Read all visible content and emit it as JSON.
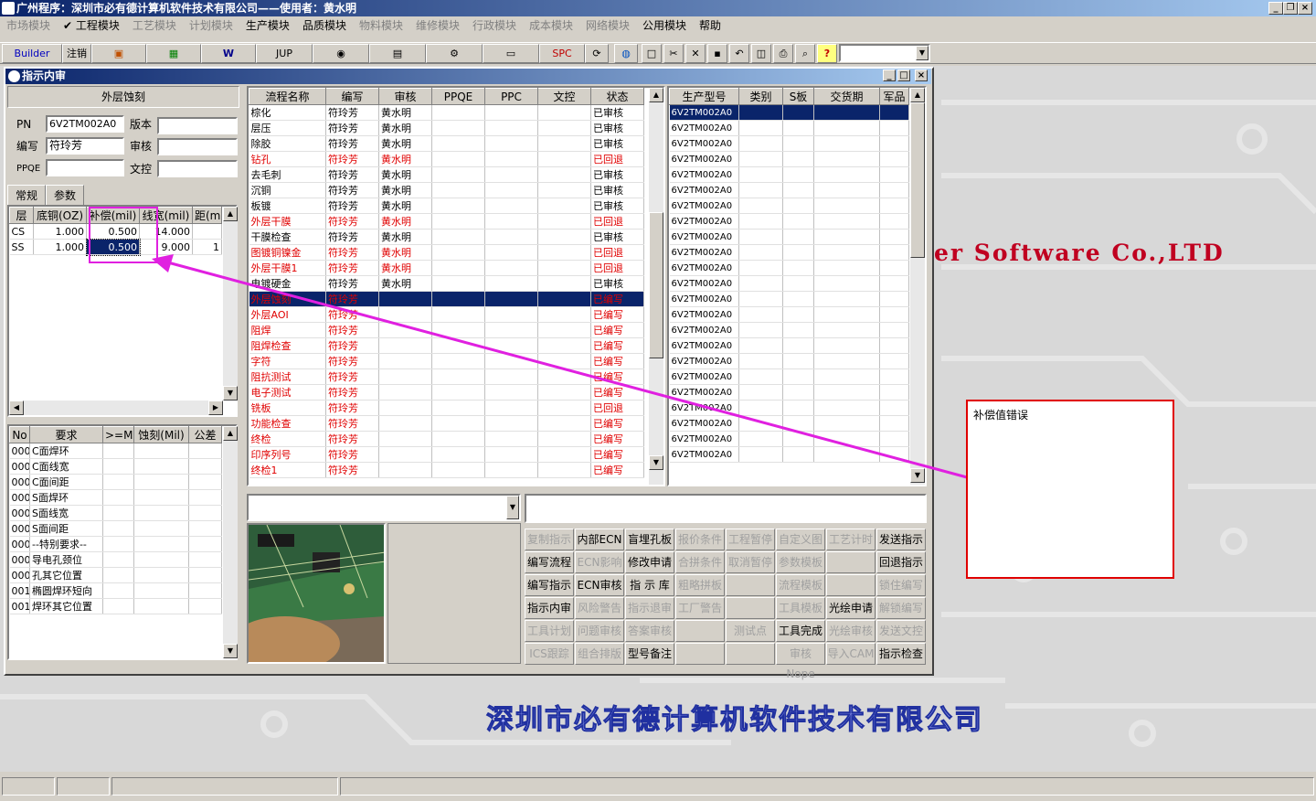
{
  "app": {
    "title": "广州程序：深圳市必有德计算机软件技术有限公司——使用者：黄水明"
  },
  "menu": [
    {
      "label": "市场模块",
      "enabled": false
    },
    {
      "label": "✔ 工程模块",
      "enabled": true
    },
    {
      "label": "工艺模块",
      "enabled": false
    },
    {
      "label": "计划模块",
      "enabled": false
    },
    {
      "label": "生产模块",
      "enabled": true
    },
    {
      "label": "品质模块",
      "enabled": true
    },
    {
      "label": "物料模块",
      "enabled": false
    },
    {
      "label": "维修模块",
      "enabled": false
    },
    {
      "label": "行政模块",
      "enabled": false
    },
    {
      "label": "成本模块",
      "enabled": false
    },
    {
      "label": "网络模块",
      "enabled": false
    },
    {
      "label": "公用模块",
      "enabled": true
    },
    {
      "label": "帮助",
      "enabled": true
    }
  ],
  "toolbar": {
    "builder": "Builder",
    "logout": "注销",
    "jup": "JUP",
    "spc": "SPC"
  },
  "desktop": {
    "company_en": "er Software Co.,LTD",
    "company_cn": "深圳市必有德计算机软件技术有限公司"
  },
  "window": {
    "title": "指示内审"
  },
  "left": {
    "process_title": "外层蚀刻",
    "pn_label": "PN",
    "pn": "6V2TM002A0",
    "version_label": "版本",
    "writer_label": "编写",
    "writer": "符玲芳",
    "review_label": "审核",
    "ppqe_label": "PPQE",
    "doc_label": "文控",
    "tabs": [
      "常规",
      "参数"
    ],
    "param_headers": [
      "层",
      "底铜(OZ)",
      "补偿(mil)",
      "线宽(mil)",
      "距(mi"
    ],
    "params": [
      [
        "CS",
        "1.000",
        "0.500",
        "14.000",
        ""
      ],
      [
        "SS",
        "1.000",
        "0.500",
        "9.000",
        "1"
      ]
    ],
    "req_headers": [
      "No",
      "要求",
      ">=Mil",
      "蚀刻(Mil)",
      "公差"
    ],
    "reqs": [
      [
        "000",
        "C面焊环"
      ],
      [
        "000",
        "C面线宽"
      ],
      [
        "000",
        "C面间距"
      ],
      [
        "000",
        "S面焊环"
      ],
      [
        "000",
        "S面线宽"
      ],
      [
        "000",
        "S面间距"
      ],
      [
        "000",
        "--特别要求--"
      ],
      [
        "000",
        "导电孔颈位"
      ],
      [
        "000",
        "孔其它位置"
      ],
      [
        "001",
        "椭圆焊环短向"
      ],
      [
        "001",
        "焊环其它位置"
      ]
    ]
  },
  "flow": {
    "headers": [
      "流程名称",
      "编写",
      "审核",
      "PPQE",
      "PPC",
      "文控",
      "状态"
    ],
    "rows": [
      [
        "棕化",
        "符玲芳",
        "黄水明",
        "已审核",
        "n"
      ],
      [
        "层压",
        "符玲芳",
        "黄水明",
        "已审核",
        "n"
      ],
      [
        "除胶",
        "符玲芳",
        "黄水明",
        "已审核",
        "n"
      ],
      [
        "钻孔",
        "符玲芳",
        "黄水明",
        "已回退",
        "r"
      ],
      [
        "去毛刺",
        "符玲芳",
        "黄水明",
        "已审核",
        "n"
      ],
      [
        "沉铜",
        "符玲芳",
        "黄水明",
        "已审核",
        "n"
      ],
      [
        "板镀",
        "符玲芳",
        "黄水明",
        "已审核",
        "n"
      ],
      [
        "外层干膜",
        "符玲芳",
        "黄水明",
        "已回退",
        "r"
      ],
      [
        "干膜检查",
        "符玲芳",
        "黄水明",
        "已审核",
        "n"
      ],
      [
        "图镀铜镍金",
        "符玲芳",
        "黄水明",
        "已回退",
        "r"
      ],
      [
        "外层干膜1",
        "符玲芳",
        "黄水明",
        "已回退",
        "r"
      ],
      [
        "电镀硬金",
        "符玲芳",
        "黄水明",
        "已审核",
        "n"
      ],
      [
        "外层蚀刻",
        "符玲芳",
        "",
        "已编写",
        "s"
      ],
      [
        "外层AOI",
        "符玲芳",
        "",
        "已编写",
        "r"
      ],
      [
        "阻焊",
        "符玲芳",
        "",
        "已编写",
        "r"
      ],
      [
        "阻焊检查",
        "符玲芳",
        "",
        "已编写",
        "r"
      ],
      [
        "字符",
        "符玲芳",
        "",
        "已编写",
        "r"
      ],
      [
        "阻抗测试",
        "符玲芳",
        "",
        "已编写",
        "r"
      ],
      [
        "电子测试",
        "符玲芳",
        "",
        "已编写",
        "r"
      ],
      [
        "铣板",
        "符玲芳",
        "",
        "已回退",
        "r"
      ],
      [
        "功能检查",
        "符玲芳",
        "",
        "已编写",
        "r"
      ],
      [
        "终检",
        "符玲芳",
        "",
        "已编写",
        "r"
      ],
      [
        "印序列号",
        "符玲芳",
        "",
        "已编写",
        "r"
      ],
      [
        "终检1",
        "符玲芳",
        "",
        "已编写",
        "r"
      ]
    ]
  },
  "models": {
    "headers": [
      "生产型号",
      "类别",
      "S板",
      "交货期",
      "军品"
    ],
    "value": "6V2TM002A0",
    "count": 23
  },
  "annotation": {
    "text": "补偿值错误"
  },
  "buttons": [
    [
      "复制指示",
      "d"
    ],
    [
      "内部ECN",
      "e"
    ],
    [
      "盲埋孔板",
      "e"
    ],
    [
      "报价条件",
      "d"
    ],
    [
      "工程暂停",
      "d"
    ],
    [
      "自定义图",
      "d"
    ],
    [
      "工艺计时",
      "d"
    ],
    [
      "发送指示",
      "e"
    ],
    [
      "编写流程",
      "e"
    ],
    [
      "ECN影响",
      "d"
    ],
    [
      "修改申请",
      "e"
    ],
    [
      "合拼条件",
      "d"
    ],
    [
      "取消暂停",
      "d"
    ],
    [
      "参数模板",
      "d"
    ],
    [
      "",
      "d"
    ],
    [
      "回退指示",
      "e"
    ],
    [
      "编写指示",
      "e"
    ],
    [
      "ECN审核",
      "e"
    ],
    [
      "指 示 库",
      "e"
    ],
    [
      "粗略拼板",
      "d"
    ],
    [
      "",
      "d"
    ],
    [
      "流程模板",
      "d"
    ],
    [
      "",
      "d"
    ],
    [
      "锁住编写",
      "d"
    ],
    [
      "指示内审",
      "e"
    ],
    [
      "风险警告",
      "d"
    ],
    [
      "指示退审",
      "d"
    ],
    [
      "工厂警告",
      "d"
    ],
    [
      "",
      "d"
    ],
    [
      "工具模板",
      "d"
    ],
    [
      "光绘申请",
      "e"
    ],
    [
      "解锁编写",
      "d"
    ],
    [
      "工具计划",
      "d"
    ],
    [
      "问题审核",
      "d"
    ],
    [
      "答案审核",
      "d"
    ],
    [
      "",
      "d"
    ],
    [
      "测试点",
      "d"
    ],
    [
      "工具完成",
      "e"
    ],
    [
      "光绘审核",
      "d"
    ],
    [
      "发送文控",
      "d"
    ],
    [
      "ICS跟踪",
      "d"
    ],
    [
      "组合排版",
      "d"
    ],
    [
      "型号备注",
      "e"
    ],
    [
      "",
      "d"
    ],
    [
      "",
      "d"
    ],
    [
      "审核Nope",
      "d"
    ],
    [
      "导入CAM",
      "d"
    ],
    [
      "指示检查",
      "e"
    ]
  ]
}
